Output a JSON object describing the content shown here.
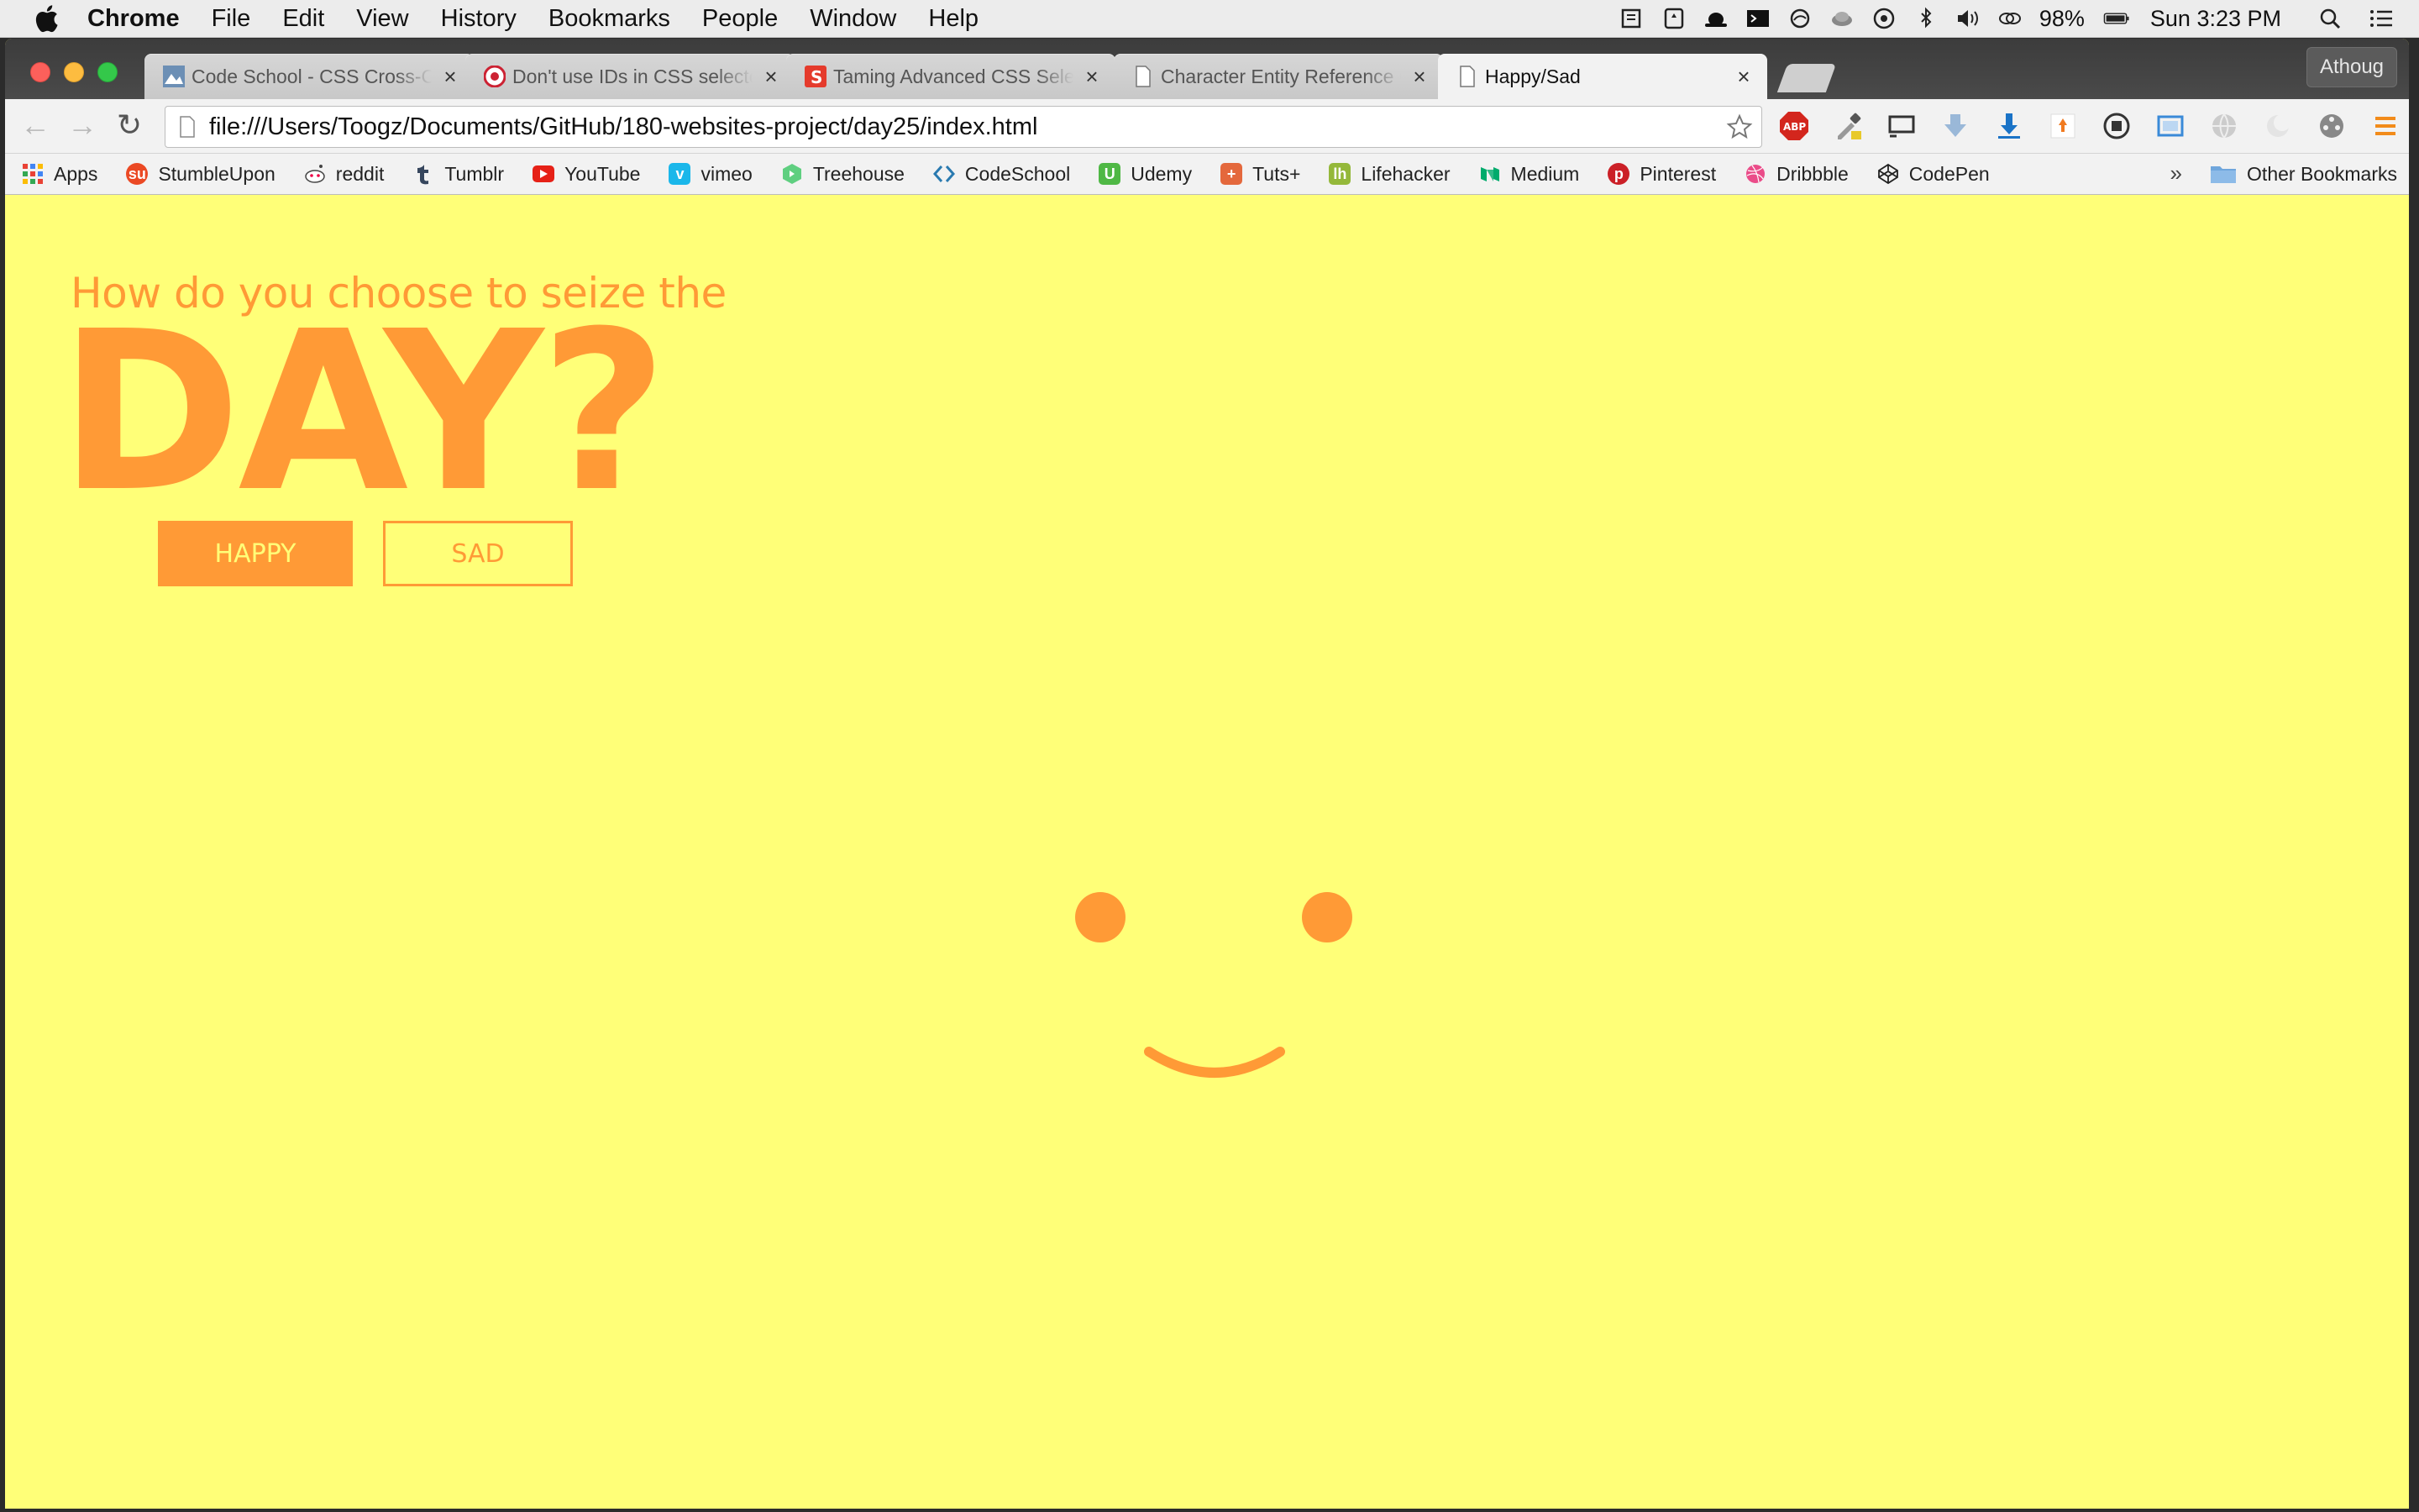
{
  "menubar": {
    "app": "Chrome",
    "items": [
      "File",
      "Edit",
      "View",
      "History",
      "Bookmarks",
      "People",
      "Window",
      "Help"
    ],
    "battery": "98%",
    "clock": "Sun 3:23 PM"
  },
  "browser": {
    "profile": "Athoug",
    "tabs": [
      {
        "title": "Code School - CSS Cross-Country",
        "favicon": "codeschool-icon"
      },
      {
        "title": "Don't use IDs in CSS selectors?",
        "favicon": "csswizardry-icon"
      },
      {
        "title": "Taming Advanced CSS Selectors",
        "favicon": "smashing-icon"
      },
      {
        "title": "Character Entity Reference Chart",
        "favicon": "page-icon"
      },
      {
        "title": "Happy/Sad",
        "favicon": "page-icon",
        "active": true
      }
    ],
    "url": "file:///Users/Toogz/Documents/GitHub/180-websites-project/day25/index.html",
    "bookmarks": [
      {
        "label": "Apps",
        "icon": "apps-grid-icon",
        "color": "#e94235"
      },
      {
        "label": "StumbleUpon",
        "icon": "stumbleupon-icon",
        "color": "#eb4924"
      },
      {
        "label": "reddit",
        "icon": "reddit-icon",
        "color": "#888888"
      },
      {
        "label": "Tumblr",
        "icon": "tumblr-icon",
        "color": "#36465d"
      },
      {
        "label": "YouTube",
        "icon": "youtube-icon",
        "color": "#e62117"
      },
      {
        "label": "vimeo",
        "icon": "vimeo-icon",
        "color": "#1ab7ea"
      },
      {
        "label": "Treehouse",
        "icon": "treehouse-icon",
        "color": "#5fcf80"
      },
      {
        "label": "CodeSchool",
        "icon": "codeschool-icon",
        "color": "#2a7ab0"
      },
      {
        "label": "Udemy",
        "icon": "udemy-icon",
        "color": "#4fb845"
      },
      {
        "label": "Tuts+",
        "icon": "tuts-icon",
        "color": "#e4683c"
      },
      {
        "label": "Lifehacker",
        "icon": "lifehacker-icon",
        "color": "#94b83a"
      },
      {
        "label": "Medium",
        "icon": "medium-icon",
        "color": "#00ab6c"
      },
      {
        "label": "Pinterest",
        "icon": "pinterest-icon",
        "color": "#cb2027"
      },
      {
        "label": "Dribbble",
        "icon": "dribbble-icon",
        "color": "#ea4c89"
      },
      {
        "label": "CodePen",
        "icon": "codepen-icon",
        "color": "#222222"
      }
    ],
    "bookmarks_more": "»",
    "other_bookmarks": "Other Bookmarks"
  },
  "page": {
    "subtitle": "How do you choose to seize the",
    "headline": "DAY?",
    "happy_button": "HAPPY",
    "sad_button": "SAD",
    "mood": "happy"
  },
  "colors": {
    "background": "#ffff78",
    "accent": "#ff9a36"
  }
}
